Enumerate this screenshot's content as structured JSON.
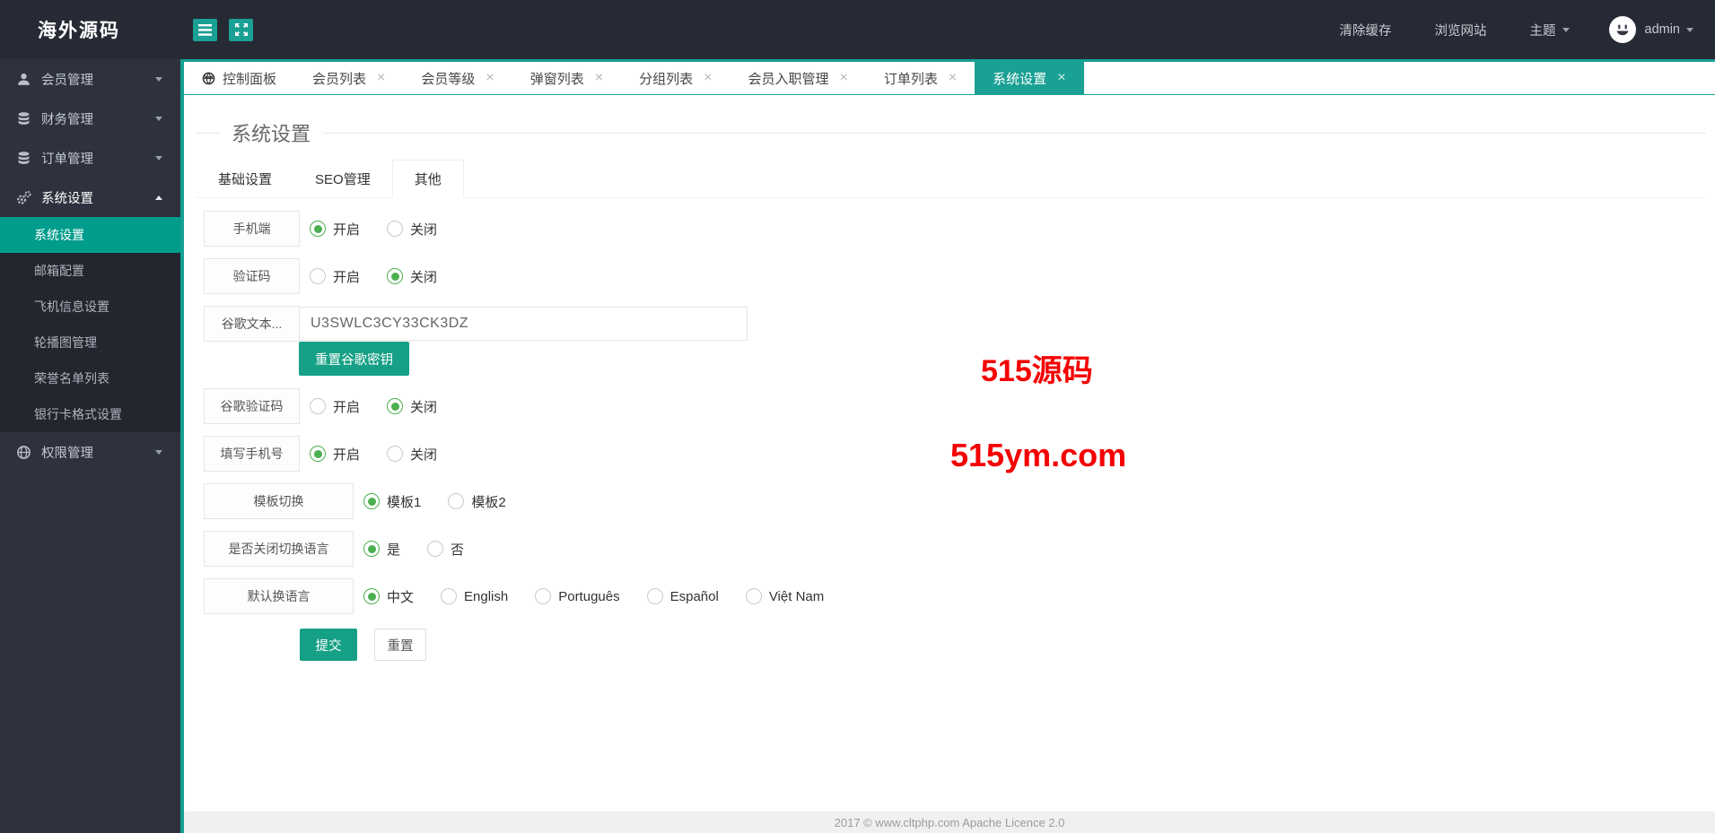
{
  "app": {
    "logo": "海外源码"
  },
  "colors": {
    "accent_teal": "#1AA094",
    "button_teal": "#16A085",
    "radio_green": "#4CAF50",
    "watermark_red": "#F40000",
    "sidebar_active": "#009C8C"
  },
  "topbar": {
    "clear_cache": "清除缓存",
    "browse_site": "浏览网站",
    "theme_label": "主题",
    "username": "admin"
  },
  "sidebar": {
    "items": [
      {
        "label": "会员管理",
        "icon": "user-icon",
        "caret": "down"
      },
      {
        "label": "财务管理",
        "icon": "database-icon",
        "caret": "down"
      },
      {
        "label": "订单管理",
        "icon": "database-icon",
        "caret": "down"
      },
      {
        "label": "系统设置",
        "icon": "gear-icon",
        "caret": "up",
        "active": true,
        "children": [
          {
            "label": "系统设置",
            "active": true
          },
          {
            "label": "邮箱配置"
          },
          {
            "label": "飞机信息设置"
          },
          {
            "label": "轮播图管理"
          },
          {
            "label": "荣誉名单列表"
          },
          {
            "label": "银行卡格式设置"
          }
        ]
      },
      {
        "label": "权限管理",
        "icon": "globe-icon",
        "caret": "down"
      }
    ]
  },
  "tabbar": {
    "tabs": [
      {
        "label": "控制面板",
        "icon": "globe",
        "closable": false
      },
      {
        "label": "会员列表",
        "closable": true
      },
      {
        "label": "会员等级",
        "closable": true
      },
      {
        "label": "弹窗列表",
        "closable": true
      },
      {
        "label": "分组列表",
        "closable": true
      },
      {
        "label": "会员入职管理",
        "closable": true
      },
      {
        "label": "订单列表",
        "closable": true
      },
      {
        "label": "系统设置",
        "closable": true,
        "active": true
      }
    ]
  },
  "main": {
    "legend": "系统设置",
    "tabs": [
      {
        "label": "基础设置"
      },
      {
        "label": "SEO管理"
      },
      {
        "label": "其他",
        "active": true
      }
    ],
    "form": {
      "rows": [
        {
          "type": "radio",
          "label": "手机端",
          "options": [
            "开启",
            "关闭"
          ],
          "selected": 0
        },
        {
          "type": "radio",
          "label": "验证码",
          "options": [
            "开启",
            "关闭"
          ],
          "selected": 1
        },
        {
          "type": "input",
          "label": "谷歌文本...",
          "value": "U3SWLC3CY33CK3DZ"
        },
        {
          "type": "button",
          "label": "重置谷歌密钥"
        },
        {
          "type": "radio",
          "label": "谷歌验证码",
          "options": [
            "开启",
            "关闭"
          ],
          "selected": 1
        },
        {
          "type": "radio",
          "label": "填写手机号",
          "options": [
            "开启",
            "关闭"
          ],
          "selected": 0
        },
        {
          "type": "radio",
          "label": "模板切换",
          "options": [
            "模板1",
            "模板2"
          ],
          "selected": 0,
          "wide": true
        },
        {
          "type": "radio",
          "label": "是否关闭切换语言",
          "options": [
            "是",
            "否"
          ],
          "selected": 0,
          "wide": true
        },
        {
          "type": "radio",
          "label": "默认换语言",
          "options": [
            "中文",
            "English",
            "Português",
            "Español",
            "Việt Nam"
          ],
          "selected": 0,
          "wide": true
        }
      ],
      "submit_label": "提交",
      "reset_label": "重置"
    },
    "watermark": {
      "line1": "515源码",
      "line2": "515ym.com"
    }
  },
  "footer": {
    "text": "2017 ©  www.cltphp.com  Apache Licence 2.0"
  }
}
